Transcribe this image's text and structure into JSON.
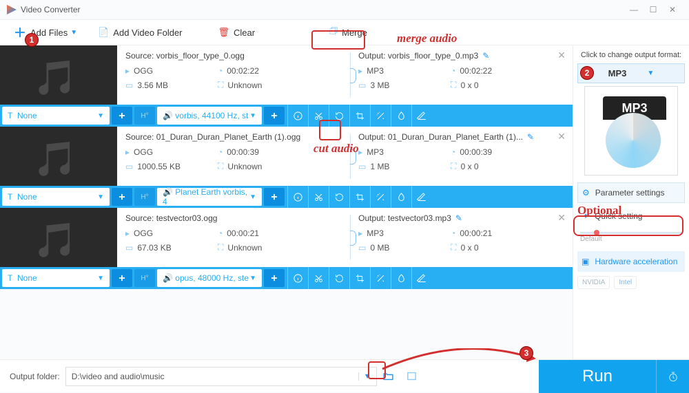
{
  "window": {
    "title": "Video Converter"
  },
  "toolbar": {
    "add_files": "Add Files",
    "add_folder": "Add Video Folder",
    "clear": "Clear",
    "merge": "Merge"
  },
  "annotations": {
    "merge_label": "merge audio",
    "cut_label": "cut audio",
    "optional_label": "Optional"
  },
  "files": [
    {
      "source_label": "Source: vorbis_floor_type_0.ogg",
      "src_fmt": "OGG",
      "src_dur": "00:02:22",
      "src_size": "3.56 MB",
      "src_dim": "Unknown",
      "output_label": "Output: vorbis_floor_type_0.mp3",
      "out_fmt": "MP3",
      "out_dur": "00:02:22",
      "out_size": "3 MB",
      "out_dim": "0 x 0",
      "sub_sel": "None",
      "audio_sel": "vorbis, 44100 Hz, st"
    },
    {
      "source_label": "Source: 01_Duran_Duran_Planet_Earth (1).ogg",
      "src_fmt": "OGG",
      "src_dur": "00:00:39",
      "src_size": "1000.55 KB",
      "src_dim": "Unknown",
      "output_label": "Output: 01_Duran_Duran_Planet_Earth (1)...",
      "out_fmt": "MP3",
      "out_dur": "00:00:39",
      "out_size": "1 MB",
      "out_dim": "0 x 0",
      "sub_sel": "None",
      "audio_sel": "Planet Earth vorbis, 4"
    },
    {
      "source_label": "Source: testvector03.ogg",
      "src_fmt": "OGG",
      "src_dur": "00:00:21",
      "src_size": "67.03 KB",
      "src_dim": "Unknown",
      "output_label": "Output: testvector03.mp3",
      "out_fmt": "MP3",
      "out_dur": "00:00:21",
      "out_size": "0 MB",
      "out_dim": "0 x 0",
      "sub_sel": "None",
      "audio_sel": "opus, 48000 Hz, ste"
    }
  ],
  "side": {
    "hint": "Click to change output format:",
    "format": "MP3",
    "format_badge": "MP3",
    "param_btn": "Parameter settings",
    "quick_btn": "Quick setting",
    "default_lbl": "Default",
    "hw_btn": "Hardware acceleration",
    "nvidia": "NVIDIA",
    "intel": "Intel"
  },
  "footer": {
    "label": "Output folder:",
    "path": "D:\\video and audio\\music",
    "run": "Run"
  }
}
